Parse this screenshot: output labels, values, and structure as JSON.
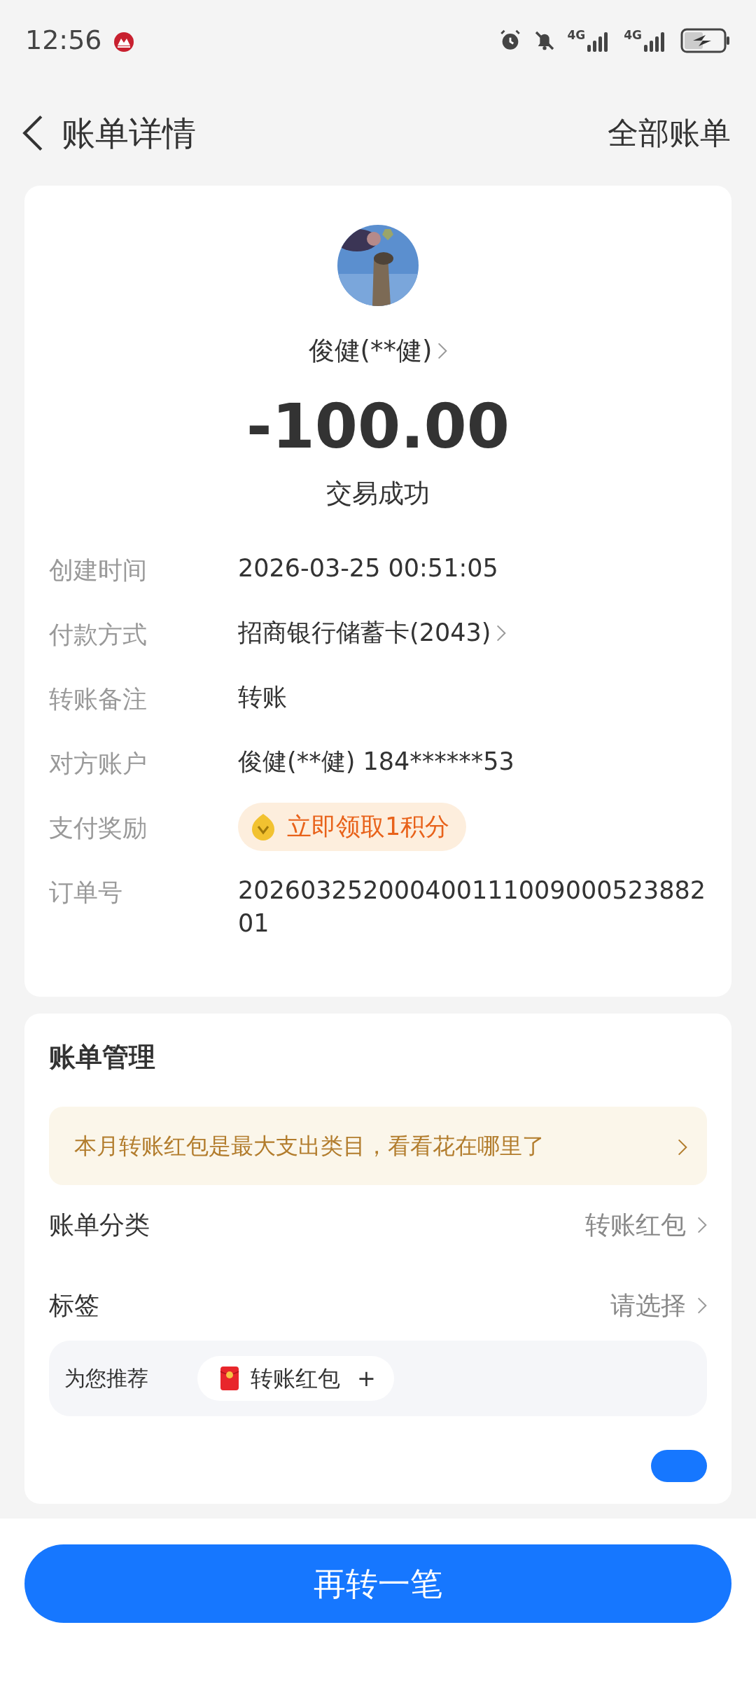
{
  "status_bar": {
    "time": "12:56",
    "network_1": "4G",
    "network_2": "4G"
  },
  "header": {
    "title": "账单详情",
    "action": "全部账单"
  },
  "summary": {
    "name": "俊健(**健)",
    "amount": "-100.00",
    "status": "交易成功"
  },
  "details": [
    {
      "kind": "text",
      "label": "创建时间",
      "value": "2026-03-25 00:51:05"
    },
    {
      "kind": "link",
      "label": "付款方式",
      "value": "招商银行储蓄卡(2043)"
    },
    {
      "kind": "text",
      "label": "转账备注",
      "value": "转账"
    },
    {
      "kind": "text",
      "label": "对方账户",
      "value": "俊健(**健) 184******53"
    },
    {
      "kind": "reward",
      "label": "支付奖励",
      "value": "立即领取1积分"
    },
    {
      "kind": "text",
      "label": "订单号",
      "value": "20260325200040011100900052388201"
    }
  ],
  "management": {
    "title": "账单管理",
    "banner": "本月转账红包是最大支出类目，看看花在哪里了",
    "rows": [
      {
        "label": "账单分类",
        "value": "转账红包"
      },
      {
        "label": "标签",
        "value": "请选择"
      }
    ],
    "recommend": {
      "label": "为您推荐",
      "tags": [
        {
          "label": "转账红包",
          "add": "+"
        }
      ]
    },
    "hidden_row": {
      "on": true
    }
  },
  "primary_button": "再转一笔"
}
